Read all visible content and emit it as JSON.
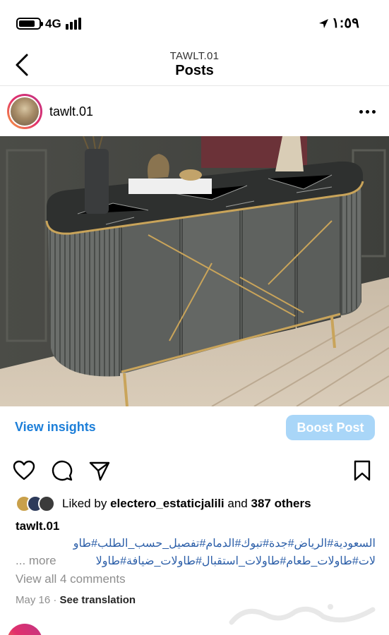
{
  "status_bar": {
    "network": "4G",
    "time": "١:٥٩"
  },
  "header": {
    "account": "TAWLT.01",
    "title": "Posts"
  },
  "post": {
    "username": "tawlt.01",
    "insights_label": "View insights",
    "boost_label": "Boost Post",
    "likes_prefix": "Liked by",
    "liked_by_user": "electero_estaticjalili",
    "likes_and": "and",
    "likes_others": "387 others",
    "caption_user": "tawlt.01",
    "caption_line1": "السعودية#الرياض#جدة#تبوك#الدمام#تفصيل_حسب_الطلب#طاو",
    "caption_line2": "لات#طاولات_طعام#طاولات_استقبال#طاولات_ضيافة#طاولا",
    "more_label": "... more",
    "comments_label": "View all 4 comments",
    "date": "May 16",
    "separator": "·",
    "translation_label": "See translation"
  },
  "colors": {
    "link_blue": "#1d7fd9",
    "boost_bg": "#a9d6f8",
    "muted": "#8e8e8e"
  }
}
